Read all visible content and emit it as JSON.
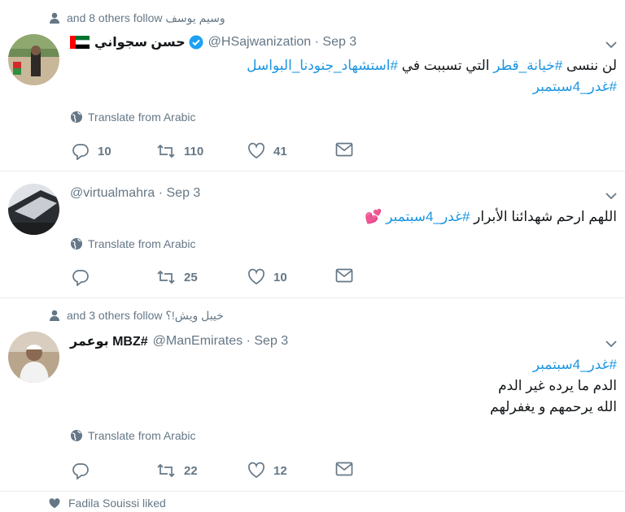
{
  "tweets": [
    {
      "context": "وسيم يوسف and 8 others follow",
      "name": "حسن سجواني",
      "handle": "@HSajwanization",
      "date": "Sep 3",
      "body_line1_prefix": "لن ننسى ",
      "body_line1_tag1": "#خيانة_قطر",
      "body_line1_mid": " التي تسببت في ",
      "body_line1_tag2": "#استشهاد_جنودنا_البواسل",
      "body_line2_tag": "#غدر_4سبتمبر",
      "translate": "Translate from Arabic",
      "replies": "10",
      "retweets": "110",
      "likes": "41"
    },
    {
      "name": "",
      "handle": "@virtualmahra",
      "date": "Sep 3",
      "body_prefix": "اللهم ارحم شهدائنا الأبرار ",
      "body_tag": "#غدر_4سبتمبر",
      "body_emoji": "💕",
      "translate": "Translate from Arabic",
      "replies": "",
      "retweets": "25",
      "likes": "10"
    },
    {
      "context": "خيبل ويش!؟ and 3 others follow",
      "name": "#MBZ بوعمر",
      "handle": "@ManEmirates",
      "date": "Sep 3",
      "body_tag": "#غدر_4سبتمبر",
      "body_line2": "الدم ما يرده غير الدم",
      "body_line3": "الله يرحمهم و يغفرلهم",
      "translate": "Translate from Arabic",
      "replies": "",
      "retweets": "22",
      "likes": "12"
    }
  ],
  "liked_context": "Fadila Souissi liked",
  "colors": {
    "link": "#1b95e0",
    "muted": "#657786",
    "verified": "#1da1f2"
  },
  "icons": [
    "person-icon",
    "verified-icon",
    "chevron-down-icon",
    "globe-icon",
    "reply-icon",
    "retweet-icon",
    "heart-icon",
    "message-icon"
  ]
}
